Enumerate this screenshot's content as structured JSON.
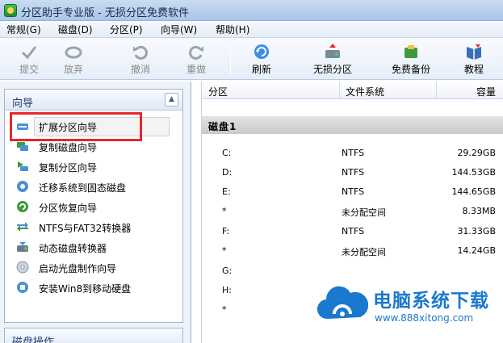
{
  "window": {
    "title": "分区助手专业版 - 无损分区免费软件"
  },
  "menubar": {
    "items": [
      {
        "label": "常规(G)"
      },
      {
        "label": "磁盘(D)"
      },
      {
        "label": "分区(P)"
      },
      {
        "label": "向导(W)"
      },
      {
        "label": "帮助(H)"
      }
    ]
  },
  "toolbar": {
    "submit": "提交",
    "discard": "放弃",
    "undo": "撤消",
    "redo": "重做",
    "refresh": "刷新",
    "lossless_partition": "无损分区",
    "free_backup": "免费备份",
    "tutorial": "教程"
  },
  "wizard": {
    "title": "向导",
    "items": [
      {
        "label": "扩展分区向导"
      },
      {
        "label": "复制磁盘向导"
      },
      {
        "label": "复制分区向导"
      },
      {
        "label": "迁移系统到固态磁盘"
      },
      {
        "label": "分区恢复向导"
      },
      {
        "label": "NTFS与FAT32转换器"
      },
      {
        "label": "动态磁盘转换器"
      },
      {
        "label": "启动光盘制作向导"
      },
      {
        "label": "安装Win8到移动硬盘"
      }
    ]
  },
  "disk_ops": {
    "title": "磁盘操作"
  },
  "table": {
    "headers": {
      "partition": "分区",
      "filesystem": "文件系统",
      "capacity": "容量"
    },
    "disk_label": "磁盘1",
    "rows": [
      {
        "partition": "C:",
        "filesystem": "NTFS",
        "capacity": "29.29GB"
      },
      {
        "partition": "D:",
        "filesystem": "NTFS",
        "capacity": "144.53GB"
      },
      {
        "partition": "E:",
        "filesystem": "NTFS",
        "capacity": "144.65GB"
      },
      {
        "partition": "*",
        "filesystem": "未分配空间",
        "capacity": "8.33MB"
      },
      {
        "partition": "F:",
        "filesystem": "NTFS",
        "capacity": "31.33GB"
      },
      {
        "partition": "*",
        "filesystem": "未分配空间",
        "capacity": "14.24GB"
      },
      {
        "partition": "G:",
        "filesystem": "",
        "capacity": ""
      },
      {
        "partition": "H:",
        "filesystem": "",
        "capacity": ""
      },
      {
        "partition": "*",
        "filesystem": "",
        "capacity": ""
      }
    ]
  },
  "watermark": {
    "title": "电脑系统下载",
    "url": "www.888xitong.com"
  },
  "colors": {
    "accent": "#1a78cf",
    "highlight": "#e8262a"
  }
}
